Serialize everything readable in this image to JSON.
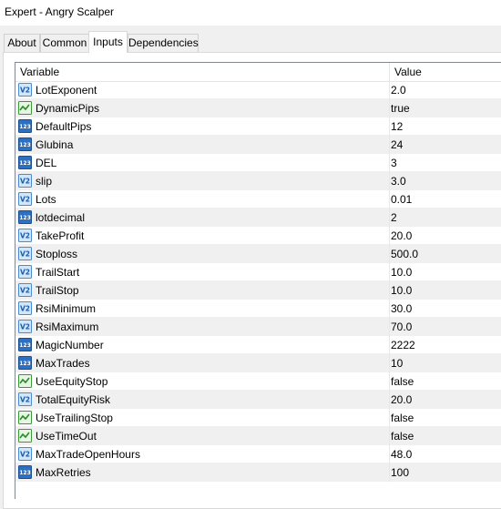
{
  "window": {
    "title": "Expert - Angry Scalper"
  },
  "tabs": [
    {
      "label": "About",
      "active": false
    },
    {
      "label": "Common",
      "active": false
    },
    {
      "label": "Inputs",
      "active": true
    },
    {
      "label": "Dependencies",
      "active": false
    }
  ],
  "table": {
    "columns": {
      "variable": "Variable",
      "value": "Value"
    },
    "rows": [
      {
        "name": "LotExponent",
        "value": "2.0",
        "type": "double-icon"
      },
      {
        "name": "DynamicPips",
        "value": "true",
        "type": "bool-icon"
      },
      {
        "name": "DefaultPips",
        "value": "12",
        "type": "int-icon"
      },
      {
        "name": "Glubina",
        "value": "24",
        "type": "int-icon"
      },
      {
        "name": "DEL",
        "value": "3",
        "type": "int-icon"
      },
      {
        "name": "slip",
        "value": "3.0",
        "type": "double-icon"
      },
      {
        "name": "Lots",
        "value": "0.01",
        "type": "double-icon"
      },
      {
        "name": "lotdecimal",
        "value": "2",
        "type": "int-icon"
      },
      {
        "name": "TakeProfit",
        "value": "20.0",
        "type": "double-icon"
      },
      {
        "name": "Stoploss",
        "value": "500.0",
        "type": "double-icon"
      },
      {
        "name": "TrailStart",
        "value": "10.0",
        "type": "double-icon"
      },
      {
        "name": "TrailStop",
        "value": "10.0",
        "type": "double-icon"
      },
      {
        "name": "RsiMinimum",
        "value": "30.0",
        "type": "double-icon"
      },
      {
        "name": "RsiMaximum",
        "value": "70.0",
        "type": "double-icon"
      },
      {
        "name": "MagicNumber",
        "value": "2222",
        "type": "int-icon"
      },
      {
        "name": "MaxTrades",
        "value": "10",
        "type": "int-icon"
      },
      {
        "name": "UseEquityStop",
        "value": "false",
        "type": "bool-icon"
      },
      {
        "name": "TotalEquityRisk",
        "value": "20.0",
        "type": "double-icon"
      },
      {
        "name": "UseTrailingStop",
        "value": "false",
        "type": "bool-icon"
      },
      {
        "name": "UseTimeOut",
        "value": "false",
        "type": "bool-icon"
      },
      {
        "name": "MaxTradeOpenHours",
        "value": "48.0",
        "type": "double-icon"
      },
      {
        "name": "MaxRetries",
        "value": "100",
        "type": "int-icon"
      }
    ]
  }
}
